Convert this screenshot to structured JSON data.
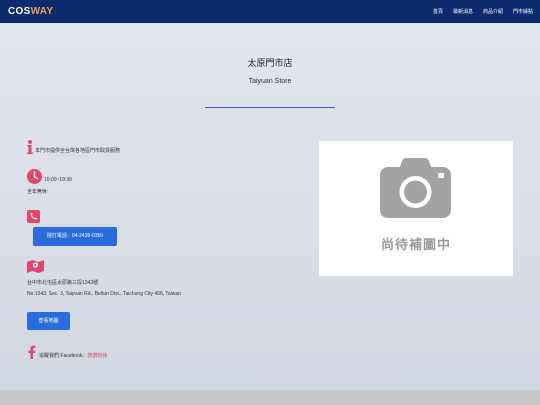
{
  "header": {
    "logo_part1": "COS",
    "logo_part2": "WAY",
    "nav": [
      "首頁",
      "最新消息",
      "商品介紹",
      "門市據點"
    ]
  },
  "store": {
    "name": "太原門市店",
    "name_en": "Taiyuan Store"
  },
  "info": {
    "notice": "本門市提供全台灣各地區門市取貨服務",
    "hours": "10:00~19:30",
    "hours_note": "全年無休",
    "call_label": "撥打電話：04-2439-0350",
    "address_zh": "台中市北屯區太原路三段1343號",
    "address_en": "No.1343, Sec. 3, Taiyuan Rd., Beitun Dist., Taichung City 406, Taiwan",
    "map_button": "查看地圖",
    "fb_text": "追蹤我們 Facebook：",
    "fb_link": "按讚粉絲"
  },
  "photo": {
    "placeholder_text": "尚待補圖中"
  },
  "colors": {
    "navbar": "#0e2a6e",
    "accent": "#f0a24a",
    "button": "#2a6cdc",
    "icon": "#e0476b"
  },
  "icons": [
    "info-icon",
    "clock-icon",
    "phone-icon",
    "map-icon",
    "facebook-icon",
    "camera-icon"
  ]
}
